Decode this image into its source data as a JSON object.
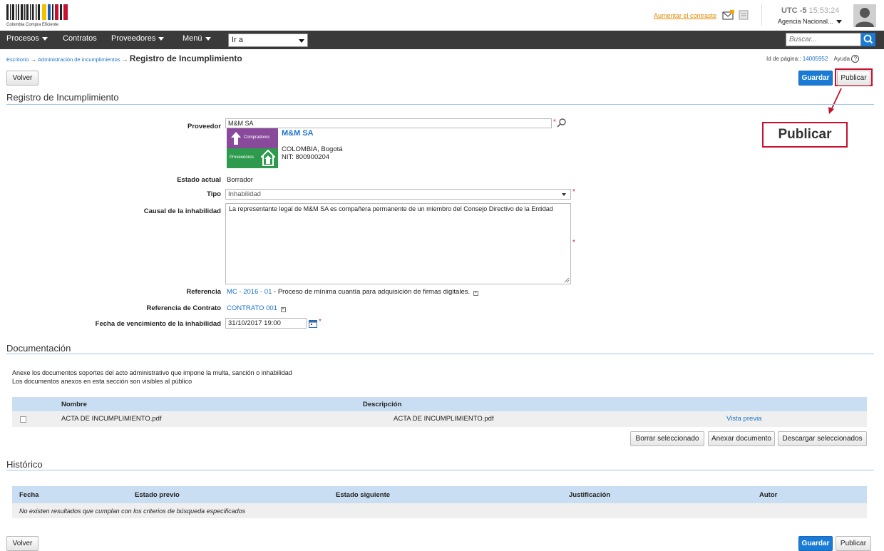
{
  "header": {
    "logo_text": "Colombia Compra Eficiente",
    "contrast_link": "Aumentar el contraste",
    "timezone": "UTC -5",
    "time": "15:53:24",
    "agency": "Agencia Nacional..."
  },
  "navbar": {
    "items": [
      "Procesos",
      "Contratos",
      "Proveedores",
      "Menú"
    ],
    "goto_value": "Ir a",
    "search_placeholder": "Buscar..."
  },
  "breadcrumb": {
    "items": [
      "Escritorio",
      "Administración de incumplimientos"
    ],
    "separator": "→",
    "current": "Registro de Incumplimiento"
  },
  "page_id": {
    "label": "Id de página::",
    "value": "14005952",
    "help": "Ayuda"
  },
  "buttons": {
    "volver": "Volver",
    "guardar": "Guardar",
    "publicar": "Publicar"
  },
  "callout": {
    "label": "Publicar"
  },
  "form": {
    "section_title": "Registro de Incumplimiento",
    "proveedor_label": "Proveedor",
    "proveedor_value": "M&M SA",
    "supplier_card": {
      "name": "M&M SA",
      "logo_top": "Compradores",
      "logo_bottom": "Proveedores",
      "location": "COLOMBIA, Bogotá",
      "nit": "NIT: 800900204"
    },
    "estado_label": "Estado actual",
    "estado_value": "Borrador",
    "tipo_label": "Tipo",
    "tipo_value": "Inhabilidad",
    "causal_label": "Causal de la inhabilidad",
    "causal_value": "La representante legal de M&M SA es compañera permanente de un miembro del Consejo Directivo de la Entidad",
    "referencia_label": "Referencia",
    "referencia_link": "MC - 2016 - 01",
    "referencia_text": " - Proceso de mínima cuantía para adquisición de firmas digitales.",
    "ref_contrato_label": "Referencia de Contrato",
    "ref_contrato_value": "CONTRATO 001",
    "fecha_label": "Fecha de vencimiento de la inhabilidad",
    "fecha_value": "31/10/2017 19:00"
  },
  "documentacion": {
    "title": "Documentación",
    "desc_line1": "Anexe los documentos soportes del acto administrativo que impone la multa, sanción o inhabilidad",
    "desc_line2": "Los documentos anexos en esta sección son visibles al público",
    "columns": [
      "Nombre",
      "Descripción"
    ],
    "rows": [
      {
        "nombre": "ACTA DE INCUMPLIMIENTO.pdf",
        "descripcion": "ACTA DE INCUMPLIMIENTO.pdf",
        "preview": "Vista previa"
      }
    ],
    "actions": [
      "Borrar seleccionado",
      "Anexar documento",
      "Descargar seleccionados"
    ]
  },
  "historico": {
    "title": "Histórico",
    "columns": [
      "Fecha",
      "Estado previo",
      "Estado siguiente",
      "Justificación",
      "Autor"
    ],
    "empty": "No existen resultados que cumplan con los criterios de búsqueda especificados"
  },
  "colors": {
    "navbar": "#3a3a3a",
    "accent": "#1a7bd6",
    "callout_border": "#c8102e",
    "table_header": "#c9def2",
    "supplier_logo": "#7b3f8f"
  }
}
